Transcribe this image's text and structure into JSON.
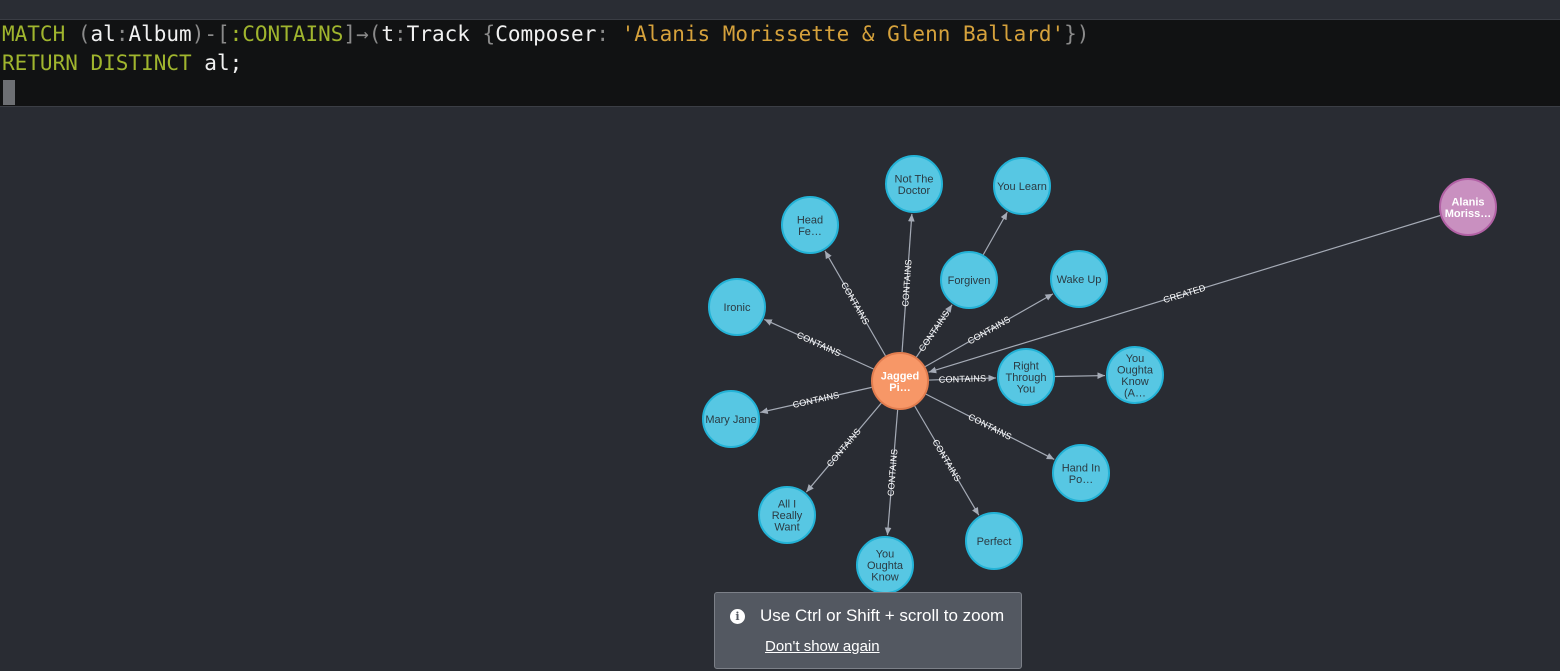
{
  "editor": {
    "line1": {
      "t1": "MATCH ",
      "t2": "(",
      "t3": "al",
      "t4": ":",
      "t5": "Album",
      "t6": ")-[",
      "t7": ":CONTAINS",
      "t8": "]→(",
      "t9": "t",
      "t10": ":",
      "t11": "Track ",
      "t12": "{",
      "t13": "Composer",
      "t14": ": ",
      "t15": "'Alanis Morissette & Glenn Ballard'",
      "t16": "})"
    },
    "line2": {
      "t1": "RETURN DISTINCT ",
      "t2": "al",
      "t3": ";"
    }
  },
  "graph": {
    "colors": {
      "album": "#f79767",
      "album_border": "#e27d4f",
      "track": "#57c7e3",
      "track_border": "#23b3d7",
      "artist": "#c990c0",
      "artist_border": "#b261a5",
      "edge": "#a5abb6"
    },
    "nodes": {
      "album": [
        "Jagged",
        "Pi…"
      ],
      "artist": [
        "Alanis",
        "Moriss…"
      ],
      "not_the_doctor": [
        "Not The",
        "Doctor"
      ],
      "you_learn": [
        "You Learn"
      ],
      "head_fe": [
        "Head",
        "Fe…"
      ],
      "forgiven": [
        "Forgiven"
      ],
      "wake_up": [
        "Wake Up"
      ],
      "ironic": [
        "Ironic"
      ],
      "right_through_you": [
        "Right",
        "Through",
        "You"
      ],
      "you_oughta_know_a": [
        "You",
        "Oughta",
        "Know",
        "(A…"
      ],
      "mary_jane": [
        "Mary Jane"
      ],
      "hand_in_po": [
        "Hand In",
        "Po…"
      ],
      "all_i_really_want": [
        "All I",
        "Really",
        "Want"
      ],
      "perfect": [
        "Perfect"
      ],
      "you_oughta_know": [
        "You",
        "Oughta",
        "Know"
      ]
    },
    "edge_labels": {
      "contains": "CONTAINS",
      "created": "CREATED"
    }
  },
  "toast": {
    "info_glyph": "i",
    "message": "Use Ctrl or Shift + scroll to zoom",
    "dismiss": "Don't show again"
  }
}
